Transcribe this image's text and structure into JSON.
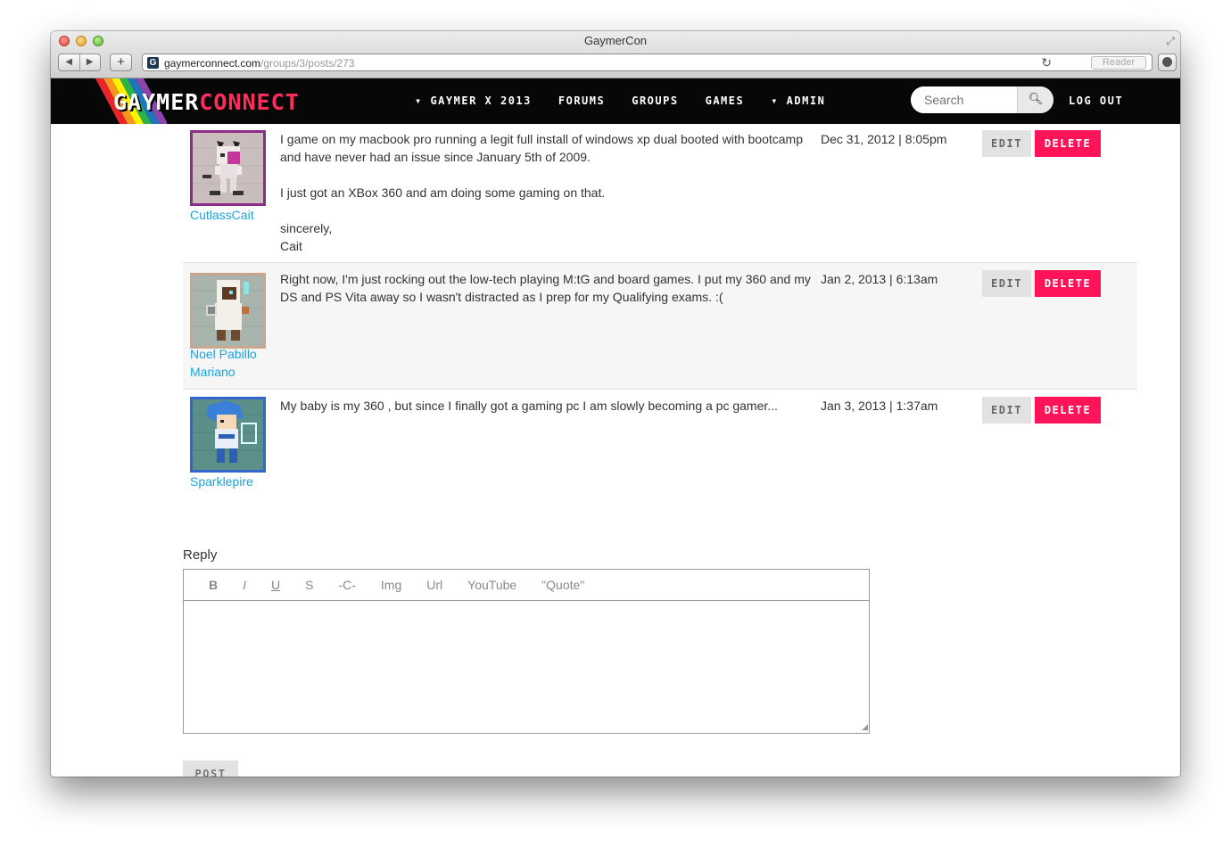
{
  "window": {
    "title": "GaymerCon",
    "url_host": "gaymerconnect.com",
    "url_path": "/groups/3/posts/273",
    "reader_label": "Reader",
    "favicon_letter": "G"
  },
  "site": {
    "logo_part1": "GAYMER",
    "logo_part2": "CONNECT",
    "nav": [
      {
        "label": "▾ GAYMER X 2013"
      },
      {
        "label": "FORUMS"
      },
      {
        "label": "GROUPS"
      },
      {
        "label": "GAMES"
      },
      {
        "label": "▾ ADMIN"
      }
    ],
    "search_placeholder": "Search",
    "logout_label": "LOG OUT",
    "accent_color": "#ff1459",
    "link_color": "#1aa3d9"
  },
  "posts": [
    {
      "username": "CutlassCait",
      "avatar_icon": "pixel-cat-girl-avatar",
      "body": [
        "I game on my macbook pro running a legit full install of windows xp dual booted with bootcamp and have never had an issue since January 5th of 2009.",
        "I just got an XBox 360 and am doing some gaming on that.",
        "sincerely,\nCait"
      ],
      "date": "Dec 31, 2012 | 8:05pm",
      "edit_label": "EDIT",
      "delete_label": "DELETE"
    },
    {
      "username": "Noel Pabillo Mariano",
      "avatar_icon": "pixel-hooded-mage-avatar",
      "body": [
        "Right now, I'm just rocking out the low-tech playing M:tG and board games. I put my 360 and my DS and PS Vita away so I wasn't distracted as I prep for my Qualifying exams. :("
      ],
      "date": "Jan 2, 2013 | 6:13am",
      "edit_label": "EDIT",
      "delete_label": "DELETE"
    },
    {
      "username": "Sparklepire",
      "avatar_icon": "pixel-blue-hair-fighter-avatar",
      "body": [
        "My baby is my 360 , but since I finally got a gaming pc I am slowly becoming a pc gamer..."
      ],
      "date": "Jan 3, 2013 | 1:37am",
      "edit_label": "EDIT",
      "delete_label": "DELETE"
    }
  ],
  "reply": {
    "label": "Reply",
    "toolbar": [
      "B",
      "I",
      "U",
      "S",
      "-C-",
      "Img",
      "Url",
      "YouTube",
      "\"Quote\""
    ],
    "text": "",
    "post_label": "POST"
  }
}
